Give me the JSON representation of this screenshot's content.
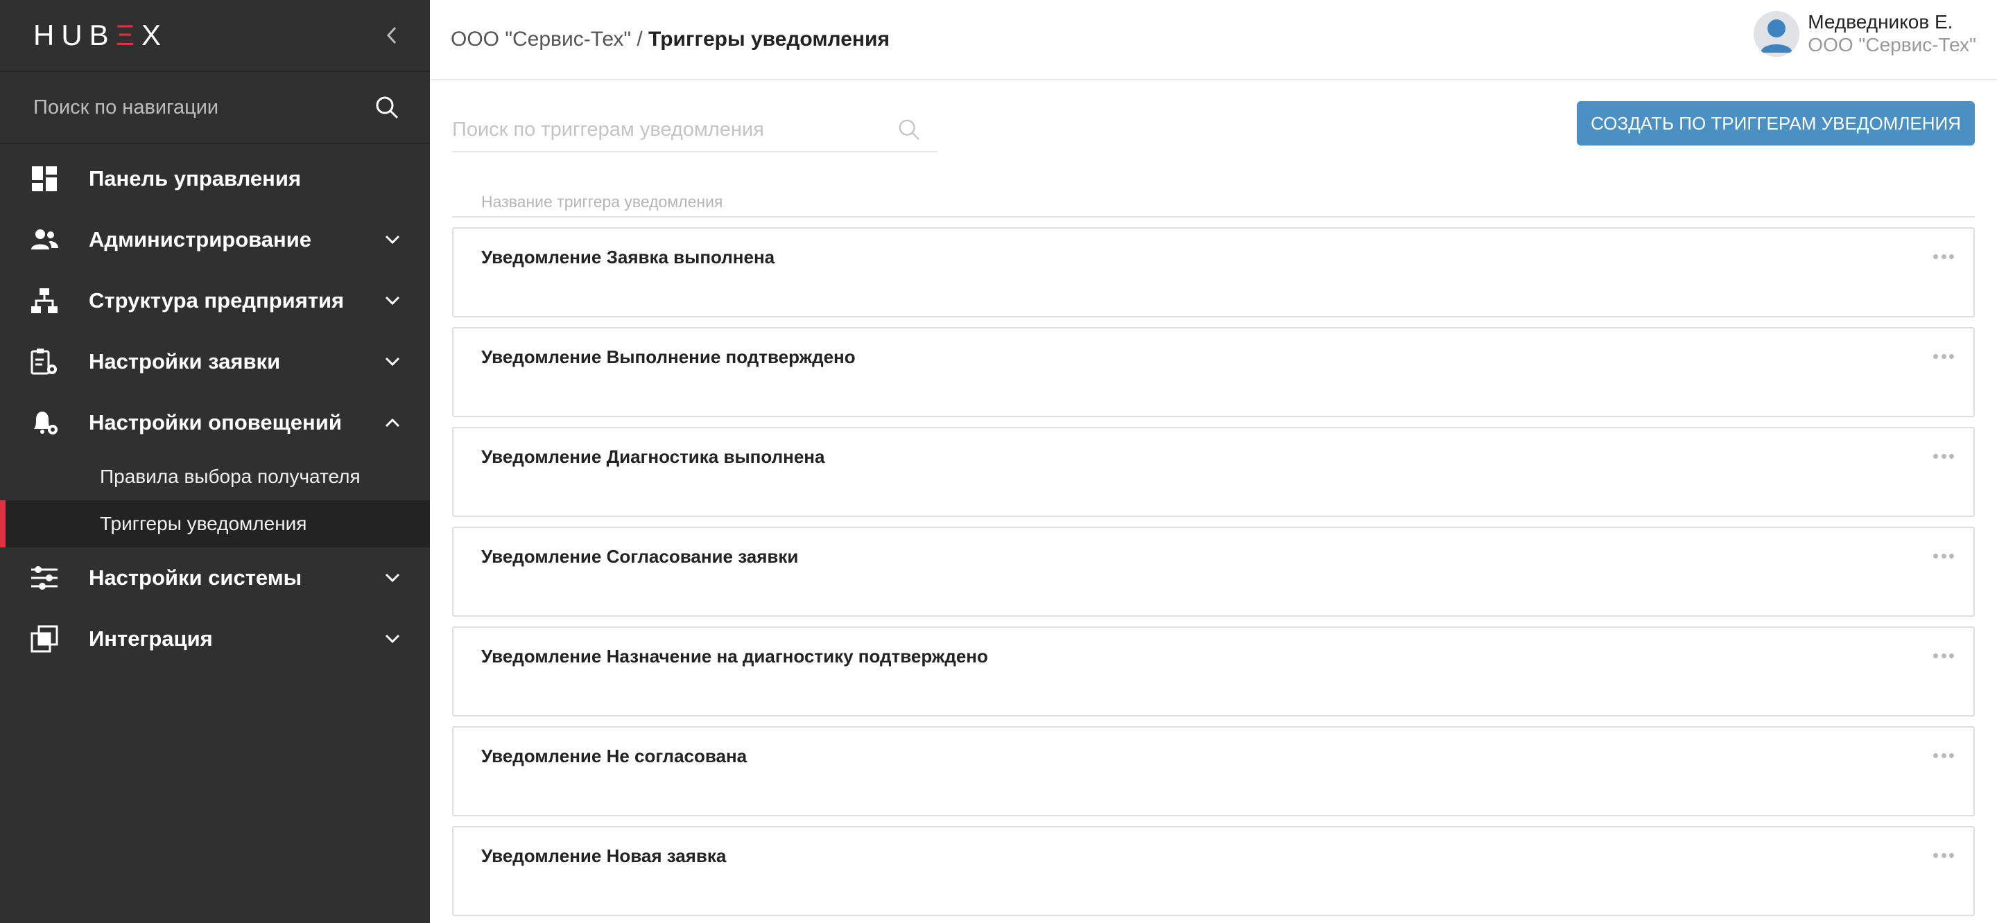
{
  "brand": {
    "logo_part1": "HUB",
    "logo_accent": "Ξ",
    "logo_part2": "X",
    "accent_color": "#e2303e"
  },
  "sidebar": {
    "search_placeholder": "Поиск по навигации",
    "items": [
      {
        "label": "Панель управления",
        "icon": "dashboard-icon"
      },
      {
        "label": "Администрирование",
        "icon": "users-icon",
        "expanded": false
      },
      {
        "label": "Структура предприятия",
        "icon": "org-structure-icon",
        "expanded": false
      },
      {
        "label": "Настройки заявки",
        "icon": "clipboard-gear-icon",
        "expanded": false
      },
      {
        "label": "Настройки оповещений",
        "icon": "bell-gear-icon",
        "expanded": true
      },
      {
        "label": "Настройки системы",
        "icon": "sliders-icon",
        "expanded": false
      },
      {
        "label": "Интеграция",
        "icon": "integration-icon",
        "expanded": false
      }
    ],
    "subitems": [
      {
        "label": "Правила выбора получателя",
        "active": false
      },
      {
        "label": "Триггеры уведомления",
        "active": true
      }
    ]
  },
  "header": {
    "breadcrumb_org": "ООО \"Сервис-Тех\" /",
    "breadcrumb_current": "Триггеры уведомления",
    "user_name": "Медведников Е.",
    "user_org": "ООО \"Сервис-Тех\""
  },
  "main": {
    "search_placeholder": "Поиск по триггерам уведомления",
    "create_button": "СОЗДАТЬ ПО ТРИГГЕРАМ УВЕДОМЛЕНИЯ",
    "column_header": "Название триггера уведомления",
    "rows": [
      "Уведомление Заявка выполнена",
      "Уведомление Выполнение подтверждено",
      "Уведомление Диагностика выполнена",
      "Уведомление Согласование заявки",
      "Уведомление Назначение на диагностику подтверждено",
      "Уведомление Не согласована",
      "Уведомление Новая заявка"
    ]
  },
  "colors": {
    "sidebar_bg": "#303030",
    "button_bg": "#4a90c2",
    "active_marker": "#e2303e"
  }
}
